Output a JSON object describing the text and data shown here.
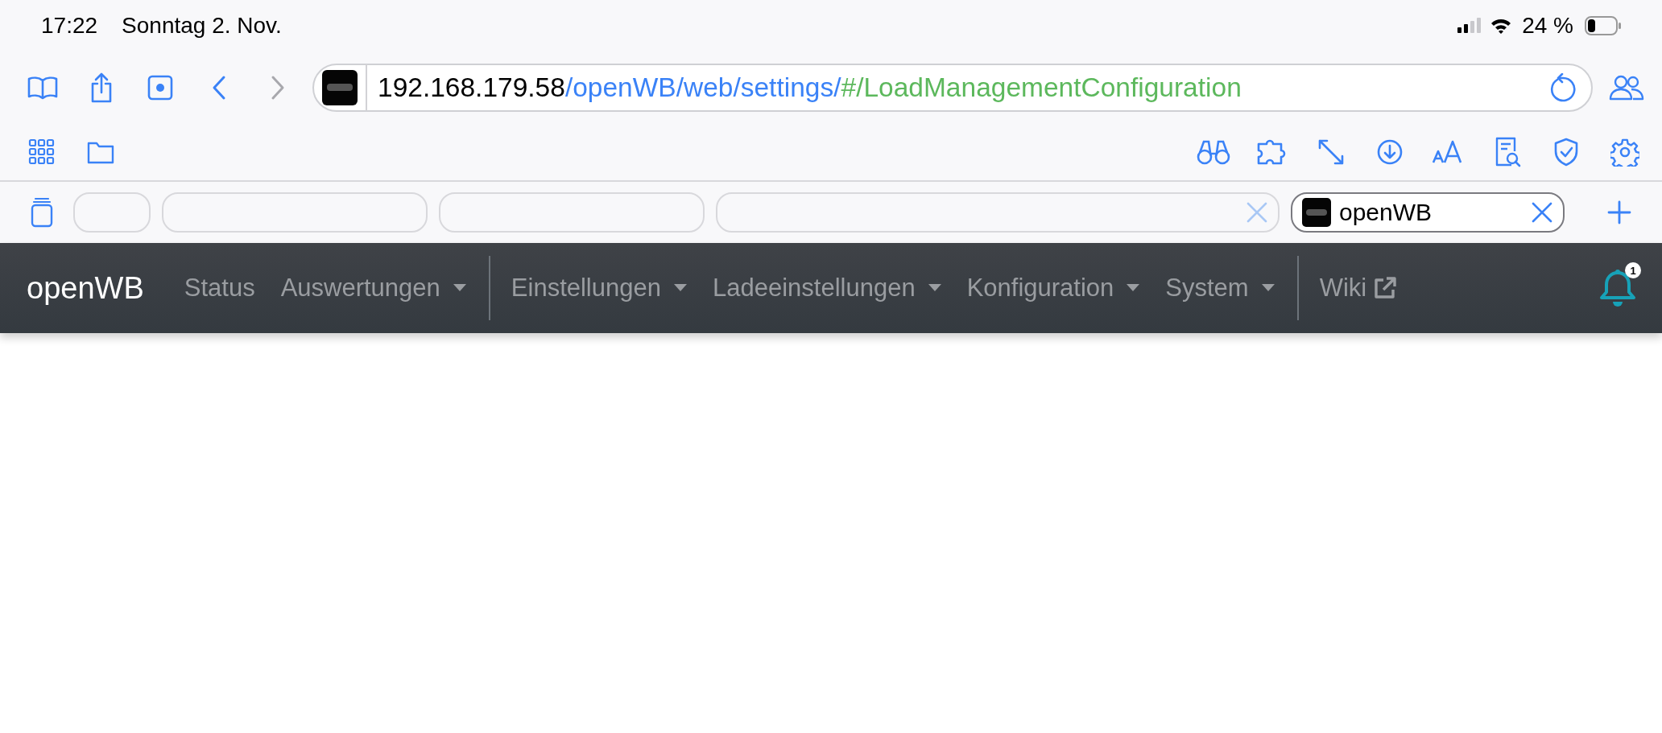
{
  "status_bar": {
    "time": "17:22",
    "date": "Sonntag 2. Nov.",
    "battery": "24 %"
  },
  "address_bar": {
    "host": "192.168.179.58",
    "path": "/openWB/web/settings/",
    "hash": "#/LoadManagementConfiguration"
  },
  "tabs": [
    {
      "selected": false
    },
    {
      "selected": false
    },
    {
      "selected": false
    },
    {
      "selected": false,
      "closable": true
    },
    {
      "selected": true,
      "label": "openWB",
      "closable": true
    }
  ],
  "navbar": {
    "brand": "openWB",
    "items": [
      {
        "kind": "link",
        "label": "Status"
      },
      {
        "kind": "dropdown",
        "label": "Auswertungen"
      },
      {
        "kind": "divider"
      },
      {
        "kind": "dropdown",
        "label": "Einstellungen"
      },
      {
        "kind": "dropdown",
        "label": "Ladeeinstellungen"
      },
      {
        "kind": "dropdown",
        "label": "Konfiguration"
      },
      {
        "kind": "dropdown",
        "label": "System"
      },
      {
        "kind": "divider"
      },
      {
        "kind": "external",
        "label": "Wiki"
      }
    ],
    "notifications": "1"
  }
}
